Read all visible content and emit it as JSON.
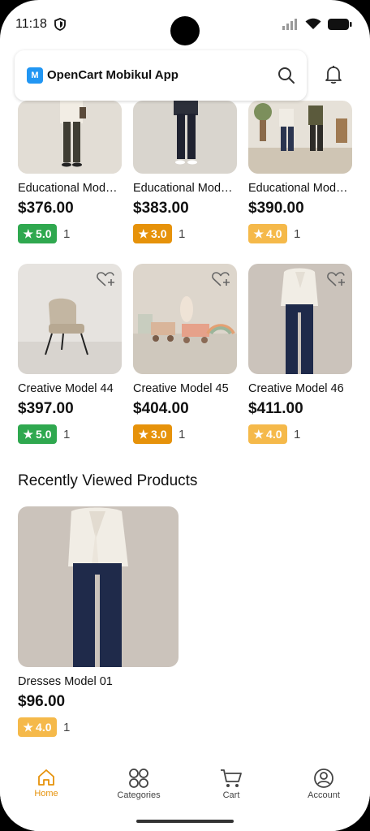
{
  "status": {
    "time": "11:18"
  },
  "header": {
    "app_title": "OpenCart Mobikul App",
    "logo_text": "M"
  },
  "colors": {
    "green": "#2fa84f",
    "orange": "#e6920a",
    "yellow": "#f5b94a",
    "accent": "#e6920a"
  },
  "products_top": [
    {
      "name": "Educational Mod…",
      "price": "$376.00",
      "rating": "5.0",
      "count": "1",
      "badge": "green"
    },
    {
      "name": "Educational Mod…",
      "price": "$383.00",
      "rating": "3.0",
      "count": "1",
      "badge": "orange"
    },
    {
      "name": "Educational Mod…",
      "price": "$390.00",
      "rating": "4.0",
      "count": "1",
      "badge": "yellow"
    }
  ],
  "products_mid": [
    {
      "name": "Creative Model 44",
      "price": "$397.00",
      "rating": "5.0",
      "count": "1",
      "badge": "green"
    },
    {
      "name": "Creative Model 45",
      "price": "$404.00",
      "rating": "3.0",
      "count": "1",
      "badge": "orange"
    },
    {
      "name": "Creative Model 46",
      "price": "$411.00",
      "rating": "4.0",
      "count": "1",
      "badge": "yellow"
    }
  ],
  "recent": {
    "title": "Recently Viewed Products",
    "items": [
      {
        "name": "Dresses Model 01",
        "price": "$96.00",
        "rating": "4.0",
        "count": "1",
        "badge": "yellow"
      }
    ]
  },
  "nav": [
    {
      "label": "Home",
      "icon": "home-icon",
      "active": true
    },
    {
      "label": "Categories",
      "icon": "categories-icon",
      "active": false
    },
    {
      "label": "Cart",
      "icon": "cart-icon",
      "active": false
    },
    {
      "label": "Account",
      "icon": "account-icon",
      "active": false
    }
  ]
}
